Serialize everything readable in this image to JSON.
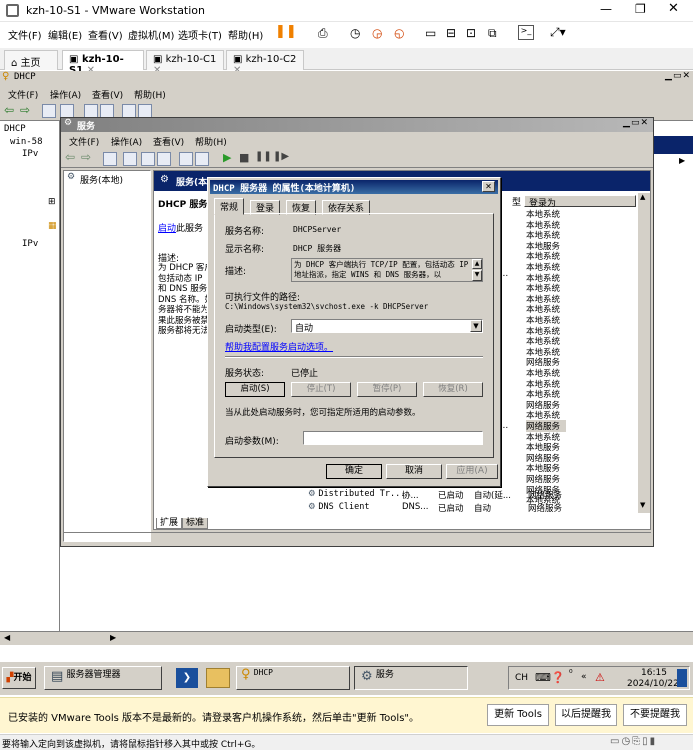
{
  "vmware": {
    "title": "kzh-10-S1 - VMware Workstation",
    "menu": [
      "文件(F)",
      "编辑(E)",
      "查看(V)",
      "虚拟机(M)",
      "选项卡(T)",
      "帮助(H)"
    ],
    "tabs": [
      "主页",
      "kzh-10-S1",
      "kzh-10-C1",
      "kzh-10-C2"
    ],
    "notify_text": "已安装的 VMware Tools 版本不是最新的。请登录客户机操作系统，然后单击\"更新 Tools\"。",
    "notify_buttons": [
      "更新 Tools",
      "以后提醒我",
      "不要提醒我"
    ],
    "status_text": "要将输入定向到该虚拟机，请将鼠标指针移入其中或按 Ctrl+G。"
  },
  "dhcp_console": {
    "title": "DHCP",
    "menu": [
      "文件(F)",
      "操作(A)",
      "查看(V)",
      "帮助(H)"
    ],
    "tree": [
      "DHCP",
      "win-58",
      "IPv",
      "IPv"
    ]
  },
  "services": {
    "title": "服务",
    "menu": [
      "文件(F)",
      "操作(A)",
      "查看(V)",
      "帮助(H)"
    ],
    "left_node": "服务(本地)",
    "header": "服务(本地)",
    "desc_title": "DHCP 服务器",
    "start_link": "启动",
    "start_link_suffix": "此服务",
    "desc_label": "描述:",
    "desc_lines": [
      "为 DHCP 客户",
      "包括动态 IP",
      "和 DNS 服务",
      "DNS 名称。如",
      "务器将不能为",
      "果此服务被禁",
      "服务都将无法"
    ],
    "col_login": "登录为",
    "login_as": [
      "本地系统",
      "本地系统",
      "本地系统",
      "本地服务",
      "本地系统",
      "本地系统",
      "本地系统",
      "本地系统",
      "本地系统",
      "本地系统",
      "本地系统",
      "本地系统",
      "本地系统",
      "本地系统",
      "网络服务",
      "本地系统",
      "本地系统",
      "本地系统",
      "网络服务",
      "本地系统",
      "网络服务",
      "本地系统",
      "本地服务",
      "网络服务",
      "本地服务",
      "网络服务",
      "网络服务",
      "本地系统"
    ],
    "bottom_rows": [
      {
        "name": "Distributed Tr...",
        "desc": "协...",
        "status": "已启动",
        "start": "自动(延...",
        "login": "网络服务"
      },
      {
        "name": "DNS Client",
        "desc": "DNS...",
        "status": "已启动",
        "start": "自动",
        "login": "网络服务"
      }
    ],
    "tabs_bottom": [
      "扩展",
      "标准"
    ]
  },
  "dialog": {
    "title": "DHCP 服务器 的属性(本地计算机)",
    "tabs": [
      "常规",
      "登录",
      "恢复",
      "依存关系"
    ],
    "service_name_label": "服务名称:",
    "service_name": "DHCPServer",
    "display_name_label": "显示名称:",
    "display_name": "DHCP 服务器",
    "desc_label": "描述:",
    "desc_text": "为 DHCP 客户端执行 TCP/IP 配置，包括动态 IP 地址指派，指定 WINS 和 DNS 服务器，以",
    "path_label": "可执行文件的路径:",
    "path": "C:\\Windows\\system32\\svchost.exe -k DHCPServer",
    "startup_label": "启动类型(E):",
    "startup_value": "自动",
    "help_link": "帮助我配置服务启动选项。",
    "status_label": "服务状态:",
    "status_value": "已停止",
    "buttons": [
      "启动(S)",
      "停止(T)",
      "暂停(P)",
      "恢复(R)"
    ],
    "hint": "当从此处启动服务时，您可指定所适用的启动参数。",
    "params_label": "启动参数(M):",
    "params_value": "",
    "ok": "确定",
    "cancel": "取消",
    "apply": "应用(A)"
  },
  "taskbar": {
    "start": "开始",
    "items": [
      "服务器管理器",
      "DHCP",
      "服务"
    ],
    "lang": "CH",
    "time": "16:15",
    "date": "2024/10/22"
  },
  "colors": {
    "xp_title": "#0a246a",
    "link": "#0000ff",
    "notify_bg": "#fff6d1"
  }
}
